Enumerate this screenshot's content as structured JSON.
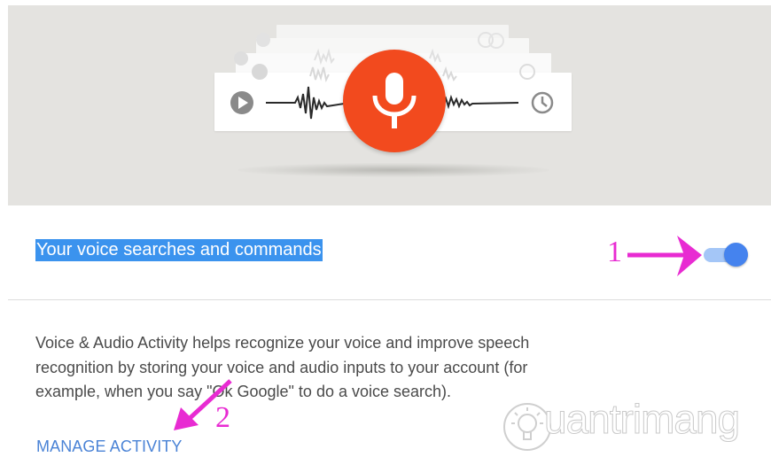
{
  "header": {
    "illustration_name": "voice-search-illustration"
  },
  "setting": {
    "title": "Your voice searches and commands",
    "toggle_on": true
  },
  "description": {
    "line1": "Voice & Audio Activity helps recognize your voice and improve speech",
    "line2": "recognition by storing your voice and audio inputs to your account (for",
    "line3": "example, when you say \"Ok Google\" to do a voice search)."
  },
  "link": {
    "manage_label": "MANAGE ACTIVITY"
  },
  "annotations": {
    "arrow1_label": "1",
    "arrow2_label": "2",
    "arrow_color": "#e82bd2"
  },
  "watermark": {
    "text": "uantrimang"
  },
  "colors": {
    "mic": "#f24a1e",
    "highlight": "#3b93ee",
    "toggle_knob": "#4583ee",
    "toggle_track": "#a4c6f7",
    "link": "#4a83d6"
  }
}
